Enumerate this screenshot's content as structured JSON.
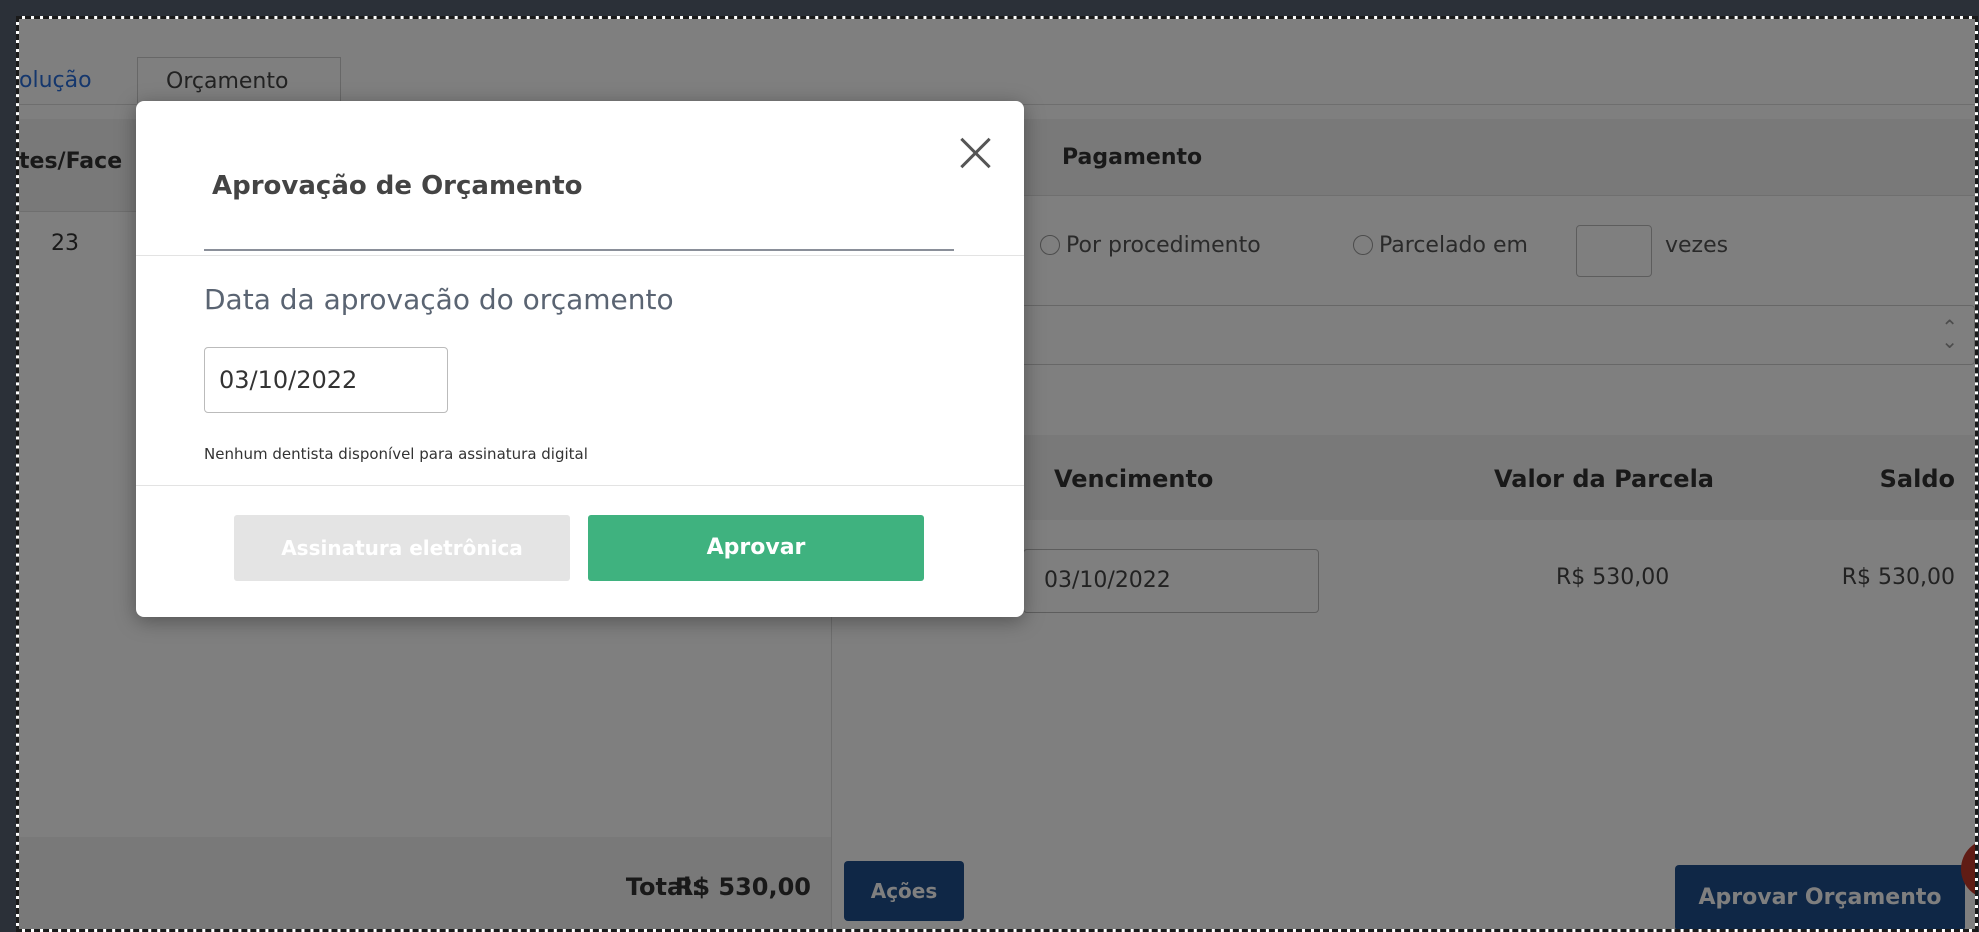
{
  "tabs": {
    "evolucao": "olução",
    "orcamento": "Orçamento"
  },
  "left_pane": {
    "header": "tes/Face",
    "tooth": "23",
    "total_label": "Total:",
    "total_value": "R$ 530,00"
  },
  "right_pane": {
    "header": "Pagamento",
    "radio_procedimento": "Por procedimento",
    "radio_parcelado": "Parcelado em",
    "vezes": "vezes",
    "table": {
      "columns": [
        "Vencimento",
        "Valor da Parcela",
        "Saldo"
      ],
      "row": {
        "vencimento": "03/10/2022",
        "valor": "R$ 530,00",
        "saldo": "R$ 530,00"
      }
    },
    "acoes_label": "Ações",
    "aprovar_orcamento_label": "Aprovar Orçamento"
  },
  "modal": {
    "title": "Aprovação de Orçamento",
    "date_label": "Data da aprovação do orçamento",
    "date_value": "03/10/2022",
    "notice": "Nenhum dentista disponível para assinatura digital",
    "sign_button": "Assinatura eletrônica",
    "approve_button": "Aprovar"
  },
  "colors": {
    "primary_blue": "#1f4e8c",
    "approve_green": "#3fb27f",
    "link_blue": "#2a6fdb"
  }
}
